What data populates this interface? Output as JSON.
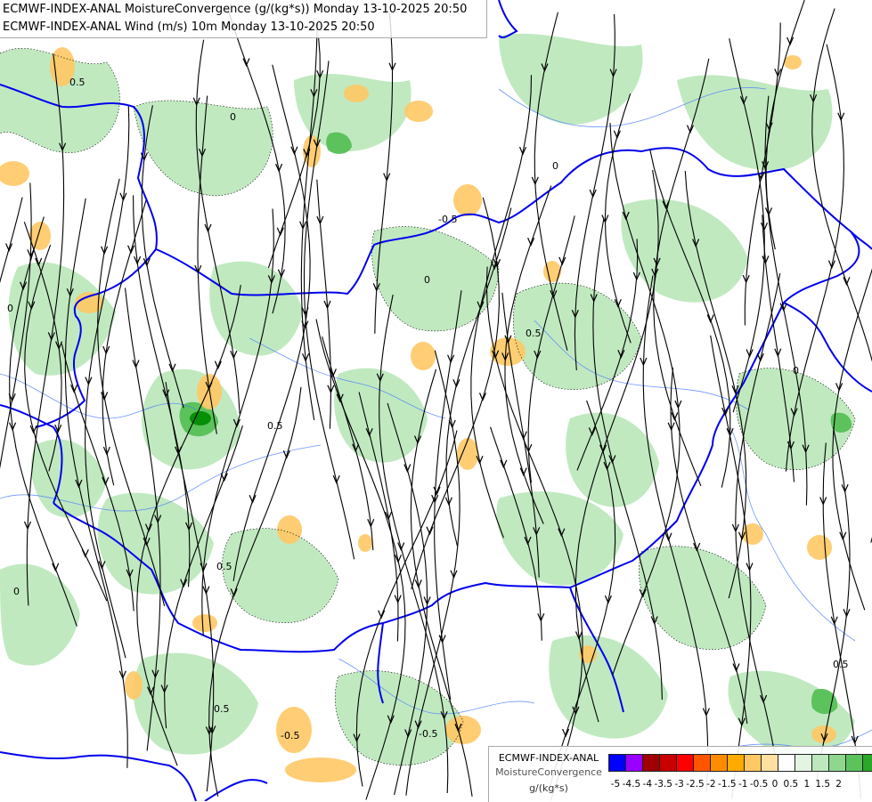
{
  "header": {
    "line1": "ECMWF-INDEX-ANAL MoistureConvergence (g/(kg*s)) Monday 13-10-2025 20:50",
    "line2": "ECMWF-INDEX-ANAL Wind (m/s) 10m Monday 13-10-2025 20:50"
  },
  "legend": {
    "title_line1": "ECMWF-INDEX-ANAL",
    "title_line2": "MoistureConvergence",
    "unit": "g/(kg*s)",
    "colors": [
      "#0000ff",
      "#9900ff",
      "#a00000",
      "#c80000",
      "#ff0000",
      "#ff5500",
      "#ff8c00",
      "#ffaa00",
      "#ffc864",
      "#ffe0a0",
      "#ffffff",
      "#e2f5e2",
      "#bde8bd",
      "#8fd68f",
      "#5cc25c",
      "#2aa82a",
      "#078f07"
    ],
    "tick_labels": [
      "-5",
      "-4.5",
      "-4",
      "-3.5",
      "-3",
      "-2.5",
      "-2",
      "-1.5",
      "-1",
      "-0.5",
      "0",
      "0.5",
      "1",
      "1.5",
      "2"
    ]
  },
  "contour_labels": [
    "0",
    "0.5",
    "-0.5"
  ]
}
